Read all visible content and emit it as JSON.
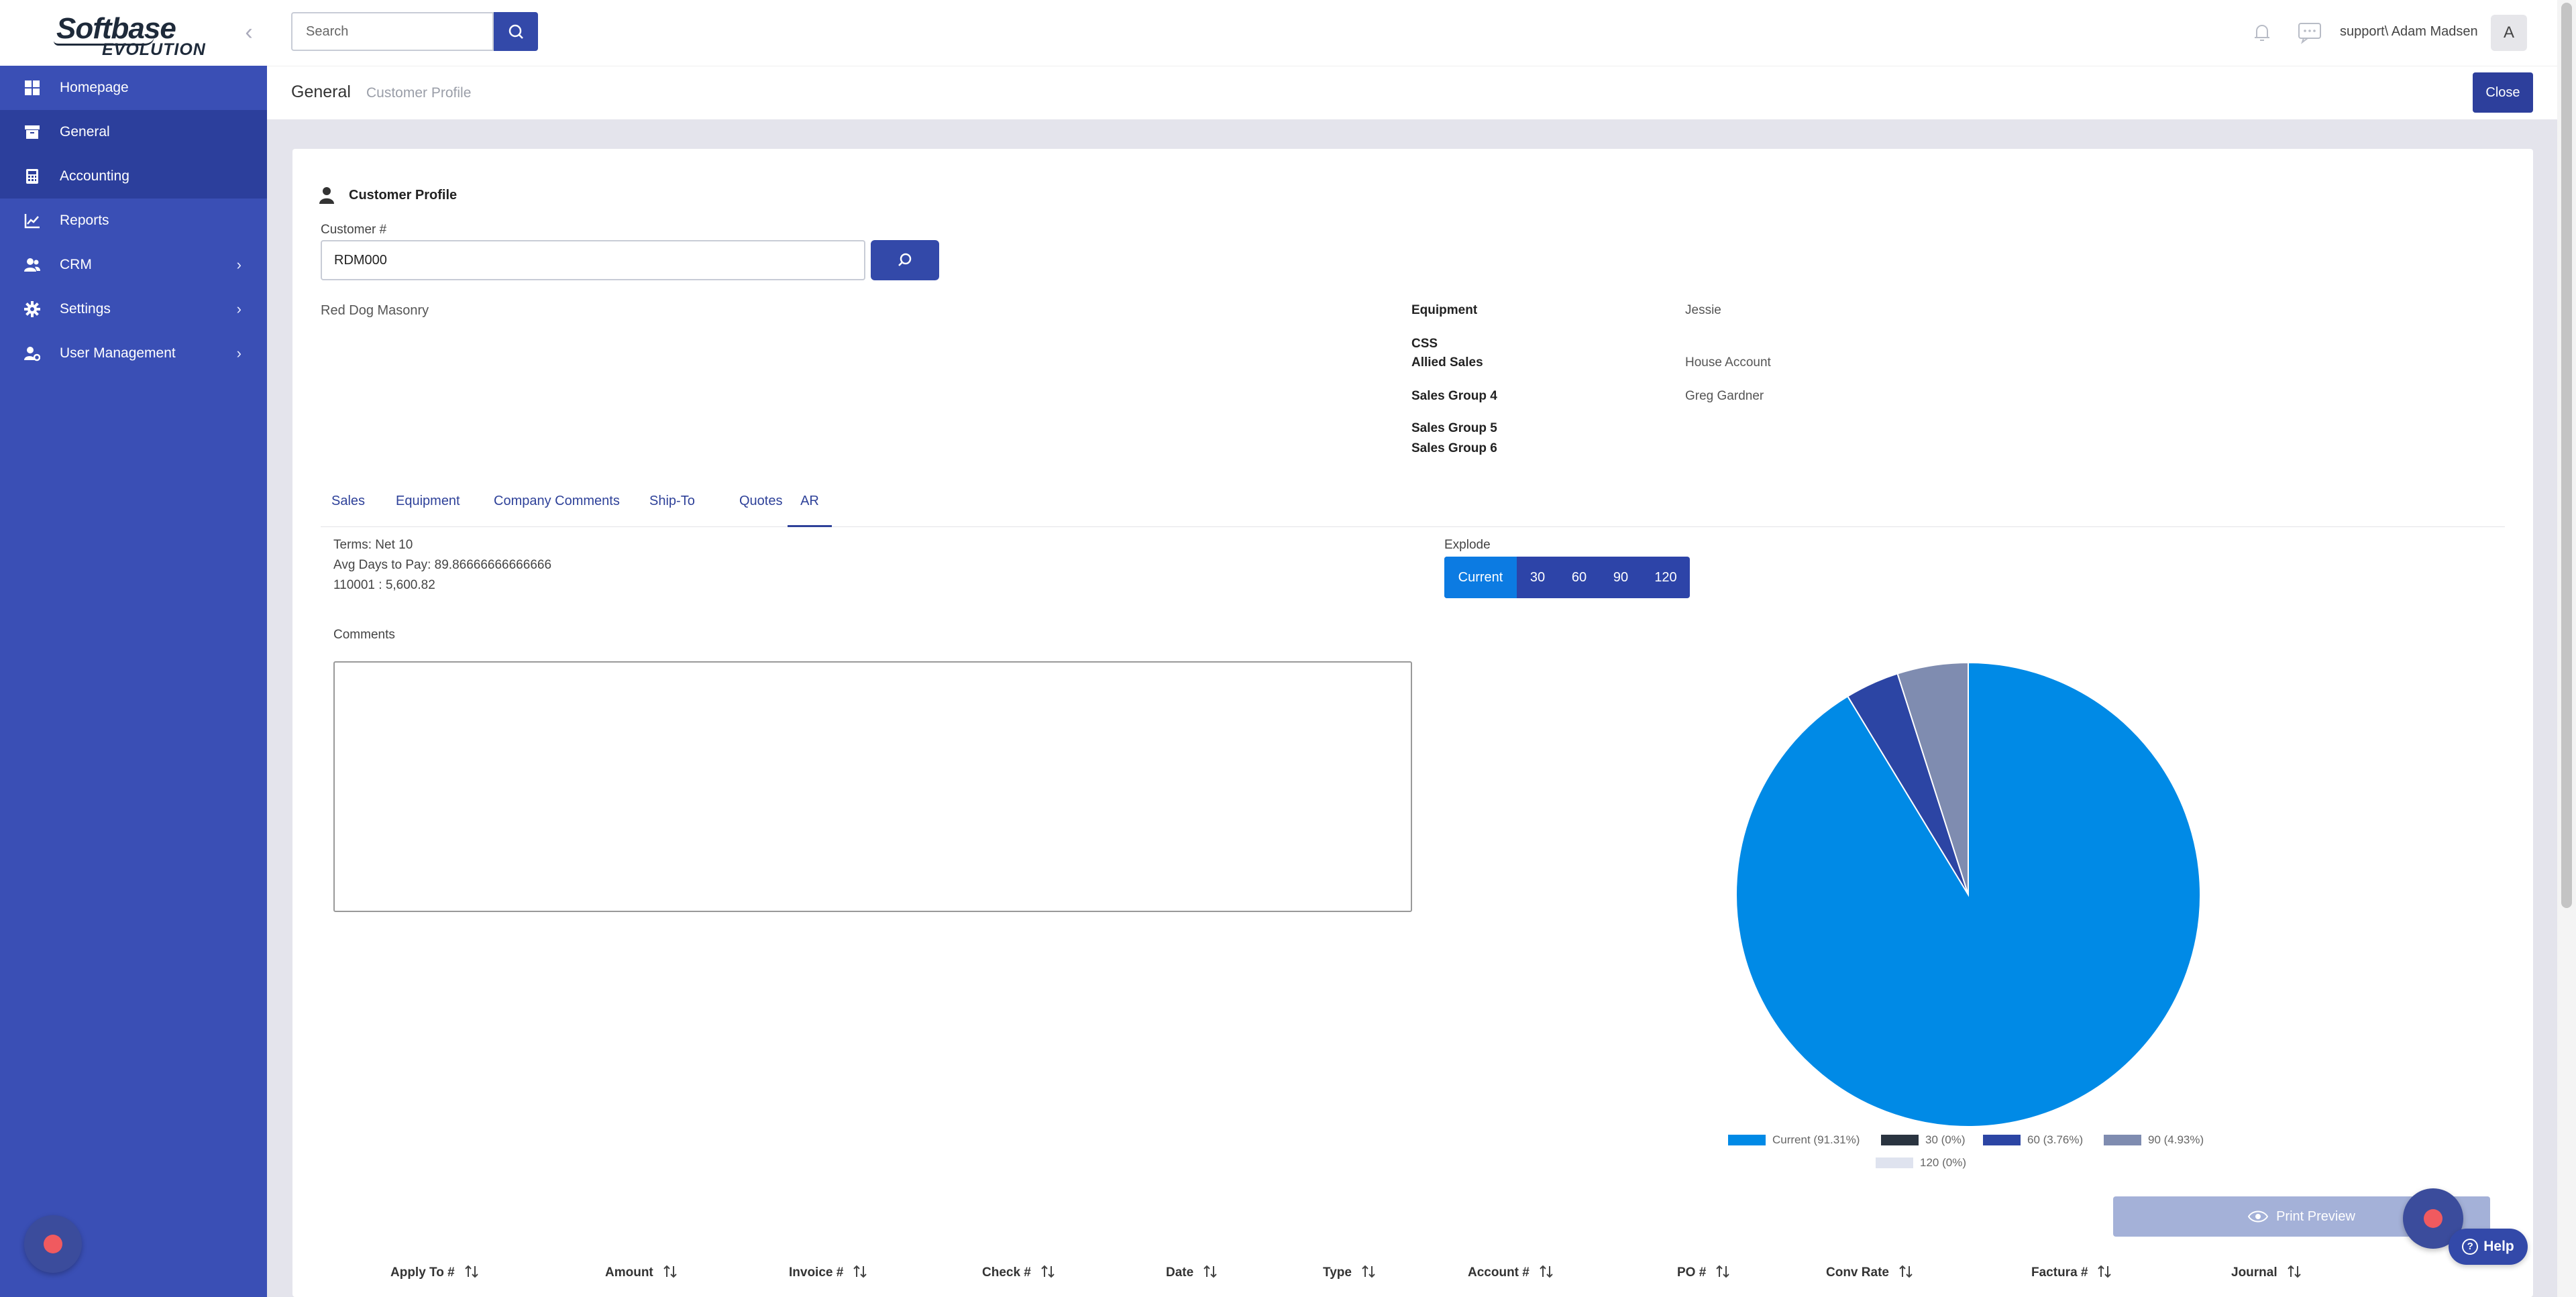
{
  "brand": {
    "line1": "Softbase",
    "line2": "EVOLUTION"
  },
  "sidebar": {
    "items": [
      {
        "label": "Homepage",
        "icon": "dashboard-icon"
      },
      {
        "label": "General",
        "icon": "archive-icon",
        "active": true
      },
      {
        "label": "Accounting",
        "icon": "calculator-icon",
        "active": true
      },
      {
        "label": "Reports",
        "icon": "chart-line-icon"
      },
      {
        "label": "CRM",
        "icon": "users-icon",
        "has_children": true
      },
      {
        "label": "Settings",
        "icon": "gear-icon",
        "has_children": true
      },
      {
        "label": "User Management",
        "icon": "user-gear-icon",
        "has_children": true
      }
    ]
  },
  "topbar": {
    "search_placeholder": "Search",
    "user": "support\\ Adam Madsen",
    "avatar_letter": "A"
  },
  "breadcrumb": {
    "section": "General",
    "page": "Customer Profile"
  },
  "close_label": "Close",
  "profile": {
    "title": "Customer Profile",
    "customer_label": "Customer #",
    "customer_value": "RDM000",
    "customer_name": "Red Dog Masonry",
    "info": [
      {
        "key": "Equipment",
        "value": "Jessie"
      },
      {
        "key": "CSS",
        "value": ""
      },
      {
        "key": "Allied Sales",
        "value": "House Account"
      },
      {
        "key": "Sales Group 4",
        "value": "Greg Gardner"
      },
      {
        "key": "Sales Group 5",
        "value": ""
      },
      {
        "key": "Sales Group 6",
        "value": ""
      }
    ]
  },
  "tabs": [
    "Sales",
    "Equipment",
    "Company Comments",
    "Ship-To",
    "Quotes",
    "AR"
  ],
  "active_tab": "AR",
  "ar": {
    "terms": "Terms: Net 10",
    "avg_days": "Avg Days to Pay: 89.86666666666666",
    "balance": "110001 : 5,600.82",
    "comments_label": "Comments",
    "comments_value": "",
    "explode_label": "Explode",
    "explode_options": [
      "Current",
      "30",
      "60",
      "90",
      "120"
    ],
    "explode_selected": "Current"
  },
  "chart_data": {
    "type": "pie",
    "labels": [
      "Current",
      "30",
      "60",
      "90",
      "120"
    ],
    "values": [
      91.31,
      0,
      3.76,
      4.93,
      0
    ],
    "legend": [
      "Current (91.31%)",
      "30 (0%)",
      "60 (3.76%)",
      "90 (4.93%)",
      "120 (0%)"
    ],
    "colors": [
      "#008ae6",
      "#2a3440",
      "#2c45a4",
      "#7f8cb0",
      "#dfe3ef"
    ],
    "exploded": "Current",
    "legend_position": "bottom"
  },
  "print_preview_label": "Print Preview",
  "table": {
    "columns": [
      "Apply To #",
      "Amount",
      "Invoice #",
      "Check #",
      "Date",
      "Type",
      "Account #",
      "PO #",
      "Conv Rate",
      "Factura #",
      "Journal"
    ]
  },
  "help_label": "Help"
}
